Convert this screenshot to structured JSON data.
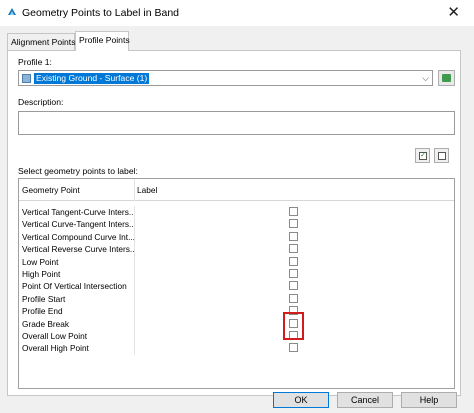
{
  "window": {
    "title": "Geometry Points to Label in Band",
    "close_glyph": "✕",
    "icon": "civil3d-app-icon"
  },
  "tabs": [
    {
      "label": "Alignment Points",
      "selected": false
    },
    {
      "label": "Profile Points",
      "selected": true
    }
  ],
  "profile": {
    "label": "Profile 1:",
    "selected_value": "Existing Ground - Surface (1)",
    "dropdown_glyph": "⌵"
  },
  "description": {
    "label": "Description:",
    "value": ""
  },
  "geometry": {
    "label": "Select geometry points to label:",
    "columns": [
      "Geometry Point",
      "Label"
    ],
    "rows": [
      {
        "name": "Vertical Tangent-Curve Inters...",
        "checked": false
      },
      {
        "name": "Vertical Curve-Tangent Inters...",
        "checked": false
      },
      {
        "name": "Vertical Compound Curve Int...",
        "checked": false
      },
      {
        "name": "Vertical Reverse Curve Inters...",
        "checked": false
      },
      {
        "name": "Low Point",
        "checked": false
      },
      {
        "name": "High Point",
        "checked": false
      },
      {
        "name": "Point Of Vertical Intersection",
        "checked": false
      },
      {
        "name": "Profile Start",
        "checked": false
      },
      {
        "name": "Profile End",
        "checked": false
      },
      {
        "name": "Grade Break",
        "checked": false
      },
      {
        "name": "Overall Low Point",
        "checked": false
      },
      {
        "name": "Overall High Point",
        "checked": false
      }
    ]
  },
  "buttons": {
    "ok": "OK",
    "cancel": "Cancel",
    "help": "Help"
  },
  "colors": {
    "selection": "#0078d7",
    "highlight_box": "#d11c1c"
  }
}
